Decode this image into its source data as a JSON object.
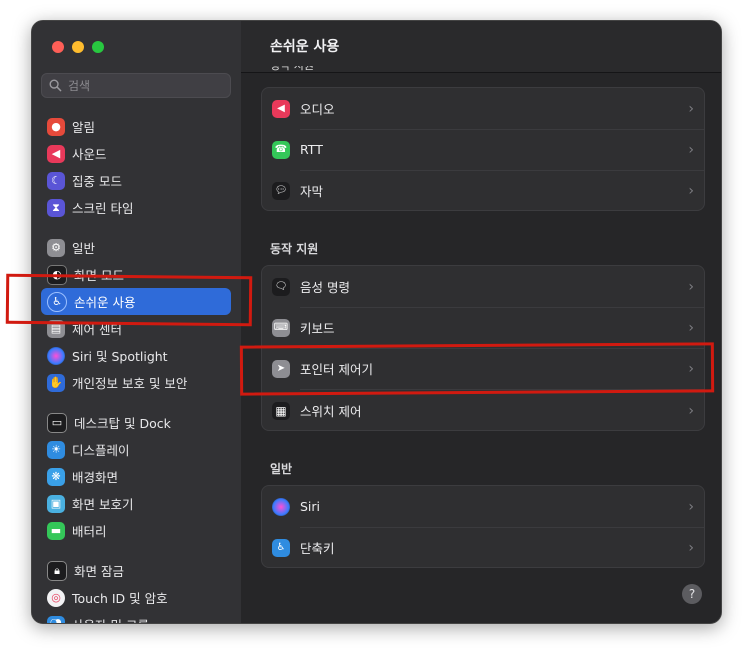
{
  "window": {
    "traffic_lights": [
      "close",
      "minimize",
      "zoom"
    ]
  },
  "search": {
    "placeholder": "검색"
  },
  "sidebar": {
    "items": [
      {
        "label": "알림",
        "icon": "bell-icon",
        "color": "#e64a3b"
      },
      {
        "label": "사운드",
        "icon": "speaker-icon",
        "color": "#e8395a"
      },
      {
        "label": "집중 모드",
        "icon": "moon-icon",
        "color": "#5a55d6"
      },
      {
        "label": "스크린 타임",
        "icon": "hourglass-icon",
        "color": "#5a55d6"
      },
      {
        "label": "일반",
        "icon": "gear-icon",
        "color": "#8e8e93"
      },
      {
        "label": "화면 모드",
        "icon": "appearance-icon",
        "color": "#1c1c1e"
      },
      {
        "label": "손쉬운 사용",
        "icon": "accessibility-icon",
        "color": "#2f6bd9",
        "selected": true
      },
      {
        "label": "제어 센터",
        "icon": "control-center-icon",
        "color": "#8e8e93"
      },
      {
        "label": "Siri 및 Spotlight",
        "icon": "siri-icon",
        "color": "#7a3fd1"
      },
      {
        "label": "개인정보 보호 및 보안",
        "icon": "hand-icon",
        "color": "#2f6bd9"
      },
      {
        "label": "데스크탑 및 Dock",
        "icon": "dock-icon",
        "color": "#1c1c1e"
      },
      {
        "label": "디스플레이",
        "icon": "sun-icon",
        "color": "#2f8ce0"
      },
      {
        "label": "배경화면",
        "icon": "wallpaper-icon",
        "color": "#3aa0e8"
      },
      {
        "label": "화면 보호기",
        "icon": "screensaver-icon",
        "color": "#4ab0e0"
      },
      {
        "label": "배터리",
        "icon": "battery-icon",
        "color": "#34c759"
      },
      {
        "label": "화면 잠금",
        "icon": "lock-icon",
        "color": "#1c1c1e"
      },
      {
        "label": "Touch ID 및 암호",
        "icon": "fingerprint-icon",
        "color": "#f2f2f4"
      },
      {
        "label": "사용자 및 그룹",
        "icon": "users-icon",
        "color": "#2f8ce0"
      }
    ]
  },
  "main": {
    "title": "손쉬운 사용",
    "cut_section_label": "청각 지원",
    "hearing": {
      "rows": [
        {
          "label": "오디오",
          "icon": "speaker-icon",
          "color": "#e8395a"
        },
        {
          "label": "RTT",
          "icon": "tty-icon",
          "color": "#34c759"
        },
        {
          "label": "자막",
          "icon": "caption-icon",
          "color": "#1c1c1e"
        }
      ]
    },
    "motor": {
      "title": "동작 지원",
      "rows": [
        {
          "label": "음성 명령",
          "icon": "voice-control-icon",
          "color": "#1c1c1e"
        },
        {
          "label": "키보드",
          "icon": "keyboard-icon",
          "color": "#8e8e93"
        },
        {
          "label": "포인터 제어기",
          "icon": "pointer-icon",
          "color": "#8e8e93"
        },
        {
          "label": "스위치 제어",
          "icon": "switch-control-icon",
          "color": "#1c1c1e"
        }
      ]
    },
    "general": {
      "title": "일반",
      "rows": [
        {
          "label": "Siri",
          "icon": "siri-icon",
          "color": "#7a3fd1"
        },
        {
          "label": "단축키",
          "icon": "shortcut-icon",
          "color": "#2f8ce0"
        }
      ]
    },
    "help_label": "?"
  },
  "annotation_color": "#d11a10"
}
